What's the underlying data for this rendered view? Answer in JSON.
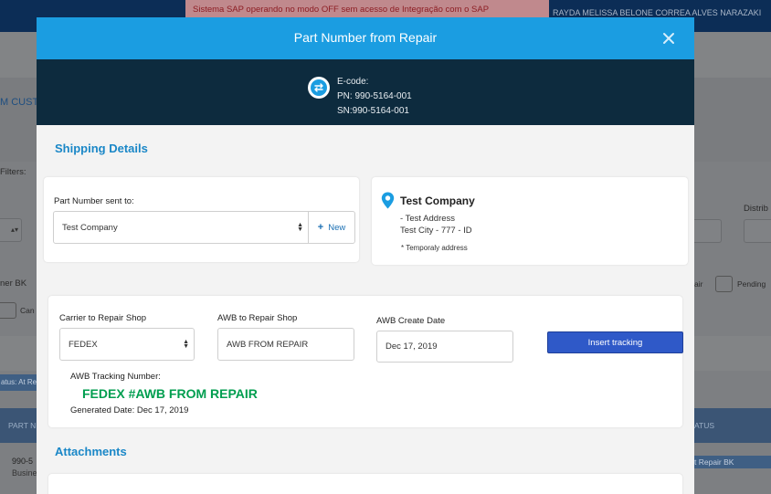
{
  "background": {
    "alert_text": "Sistema SAP operando no modo OFF sem acesso de Integração com o SAP",
    "user_name": "RAYDA MELISSA BELONE CORREA ALVES NARAZAKI",
    "custom_tab": "M CUST",
    "filters_label": "Filters:",
    "distrib_label": "Distrib",
    "owner_bk_label": "ner BK",
    "cancel_label": "Can",
    "air_label": "air",
    "pending_label": "Pending",
    "status_chip": "atus: At Re",
    "col_part_number": "PART N",
    "col_status": "ATUS",
    "row_pn": "990-5",
    "row_business": "Busine",
    "row_status": "t Repair BK"
  },
  "modal": {
    "title": "Part Number from Repair",
    "close_icon": "close-icon",
    "part_info": {
      "ecode_label": "E-code:",
      "pn": "PN: 990-5164-001",
      "sn": "SN:990-5164-001",
      "icon": "swap-icon"
    },
    "shipping": {
      "section_title": "Shipping Details",
      "sent_to_label": "Part Number sent to:",
      "sent_to_value": "Test Company",
      "new_button": "New",
      "address": {
        "company": "Test Company",
        "line1": "- Test Address",
        "line2": "Test City - 777 - ID",
        "note": "* Temporaly address"
      }
    },
    "tracking": {
      "carrier_label": "Carrier to Repair Shop",
      "carrier_value": "FEDEX",
      "awb_label": "AWB to Repair Shop",
      "awb_value": "AWB FROM REPAIR",
      "date_label": "AWB Create Date",
      "date_value": "Dec 17, 2019",
      "insert_button": "Insert tracking",
      "tracking_number_label": "AWB Tracking Number:",
      "tracking_number_value": "FEDEX #AWB FROM REPAIR",
      "generated_date": "Generated Date: Dec 17, 2019"
    },
    "attachments": {
      "section_title": "Attachments"
    }
  },
  "colors": {
    "header_blue": "#1b9de1",
    "info_navy": "#0d2b3e",
    "section_blue": "#1a87c7",
    "tracking_green": "#009e4f",
    "button_blue": "#2f59c8"
  }
}
